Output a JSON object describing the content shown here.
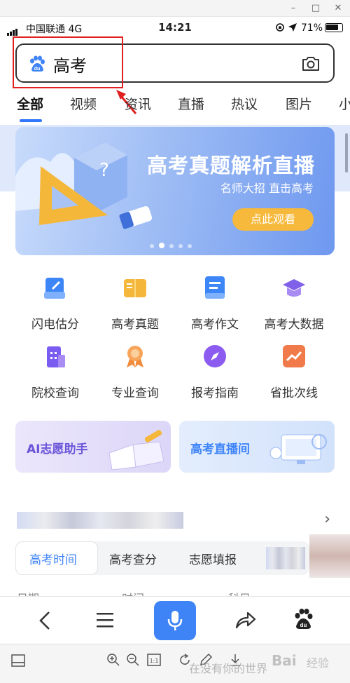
{
  "status_bar": {
    "carrier": "中国联通  4G",
    "time": "14:21",
    "battery": "71%"
  },
  "search": {
    "query": "高考"
  },
  "tabs": [
    "全部",
    "视频",
    "资讯",
    "直播",
    "热议",
    "图片",
    "小"
  ],
  "banner": {
    "title": "高考真题解析直播",
    "subtitle": "名师大招 直击高考",
    "button": "点此观看"
  },
  "grid": [
    {
      "label": "闪电估分",
      "icon": "pencil-paper-icon",
      "color": "#3d86f7"
    },
    {
      "label": "高考真题",
      "icon": "book-icon",
      "color": "#f5b73b"
    },
    {
      "label": "高考作文",
      "icon": "document-icon",
      "color": "#3d86f7"
    },
    {
      "label": "高考大数据",
      "icon": "graduation-cap-icon",
      "color": "#8060e8"
    },
    {
      "label": "院校查询",
      "icon": "building-icon",
      "color": "#7a5cf0"
    },
    {
      "label": "专业查询",
      "icon": "medal-icon",
      "color": "#f08a3c"
    },
    {
      "label": "报考指南",
      "icon": "compass-icon",
      "color": "#8c5cf0"
    },
    {
      "label": "省批次线",
      "icon": "trend-chart-icon",
      "color": "#f07a4a"
    }
  ],
  "cards": [
    {
      "label": "AI志愿助手",
      "color": "#6a55d8"
    },
    {
      "label": "高考直播间",
      "color": "#3f84f7"
    }
  ],
  "sub_tabs": [
    "高考时间",
    "高考查分",
    "志愿填报"
  ],
  "table_headers": [
    "日期",
    "时间",
    "科目"
  ],
  "watermark": {
    "left": "在没有你的世界",
    "brand": "Bai",
    "brand2": "经验"
  }
}
